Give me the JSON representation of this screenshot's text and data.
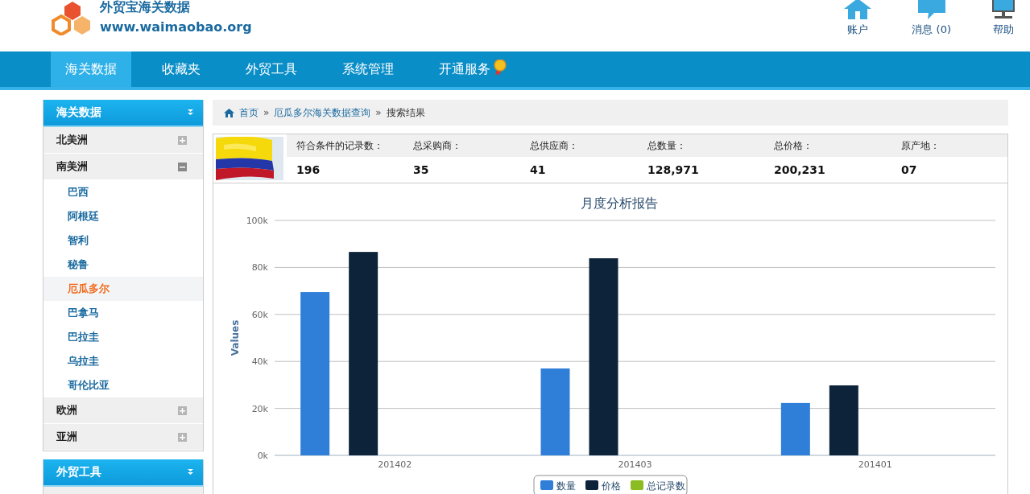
{
  "header": {
    "logo_title": "外贸宝海关数据",
    "logo_url": "www.waimaobao.org",
    "links": [
      {
        "label": "账户"
      },
      {
        "label": "消息 (0)"
      },
      {
        "label": "帮助"
      }
    ]
  },
  "nav": [
    {
      "label": "海关数据",
      "selected": true,
      "badge": false
    },
    {
      "label": "收藏夹",
      "selected": false,
      "badge": false
    },
    {
      "label": "外贸工具",
      "selected": false,
      "badge": false
    },
    {
      "label": "系统管理",
      "selected": false,
      "badge": false
    },
    {
      "label": "开通服务",
      "selected": false,
      "badge": true
    }
  ],
  "sidebar": [
    {
      "title": "海关数据",
      "groups": [
        {
          "label": "北美洲",
          "expanded": false
        },
        {
          "label": "南美洲",
          "expanded": true,
          "children": [
            {
              "label": "巴西",
              "selected": false
            },
            {
              "label": "阿根廷",
              "selected": false
            },
            {
              "label": "智利",
              "selected": false
            },
            {
              "label": "秘鲁",
              "selected": false
            },
            {
              "label": "厄瓜多尔",
              "selected": true
            },
            {
              "label": "巴拿马",
              "selected": false
            },
            {
              "label": "巴拉圭",
              "selected": false
            },
            {
              "label": "乌拉圭",
              "selected": false
            },
            {
              "label": "哥伦比亚",
              "selected": false
            }
          ]
        },
        {
          "label": "欧洲",
          "expanded": false
        },
        {
          "label": "亚洲",
          "expanded": false
        }
      ]
    },
    {
      "title": "外贸工具"
    }
  ],
  "breadcrumb": [
    {
      "label": "首页",
      "link": true
    },
    {
      "label": "厄瓜多尔海关数据查询",
      "link": true
    },
    {
      "label": "搜索结果",
      "link": false
    }
  ],
  "separator": "»",
  "summary": {
    "columns": [
      {
        "label": "符合条件的记录数：",
        "value": "196"
      },
      {
        "label": "总采购商：",
        "value": "35"
      },
      {
        "label": "总供应商：",
        "value": "41"
      },
      {
        "label": "总数量：",
        "value": "128,971"
      },
      {
        "label": "总价格：",
        "value": "200,231"
      },
      {
        "label": "原产地：",
        "value": "07"
      }
    ]
  },
  "chart_data": {
    "type": "bar",
    "title": "月度分析报告",
    "ylabel": "Values",
    "categories": [
      "201402",
      "201403",
      "201401"
    ],
    "series": [
      {
        "name": "数量",
        "color": "#2f7ed8",
        "values": [
          69500,
          37000,
          22300
        ]
      },
      {
        "name": "价格",
        "color": "#0d233a",
        "values": [
          86600,
          83900,
          29800
        ]
      },
      {
        "name": "总记录数",
        "color": "#8bbc21",
        "values": [
          0,
          0,
          0
        ]
      }
    ],
    "grid": true,
    "legend": true,
    "ylim": [
      0,
      100000
    ],
    "yticks": [
      {
        "value": 0,
        "label": "0k"
      },
      {
        "value": 20000,
        "label": "20k"
      },
      {
        "value": 40000,
        "label": "40k"
      },
      {
        "value": 60000,
        "label": "60k"
      },
      {
        "value": 80000,
        "label": "80k"
      },
      {
        "value": 100000,
        "label": "100k"
      }
    ]
  }
}
